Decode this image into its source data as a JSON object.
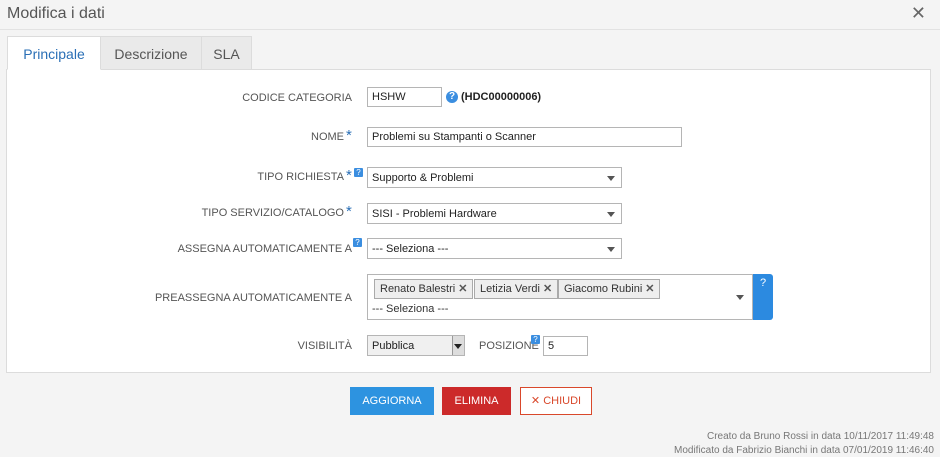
{
  "dialog": {
    "title": "Modifica i dati",
    "close_icon": "close-icon"
  },
  "tabs": [
    {
      "label": "Principale"
    },
    {
      "label": "Descrizione"
    },
    {
      "label": "SLA"
    }
  ],
  "form": {
    "codice_categoria": {
      "label": "CODICE CATEGORIA",
      "value": "HSHW",
      "code": "(HDC00000006)"
    },
    "nome": {
      "label": "NOME",
      "required_mark": "*",
      "value": "Problemi su  Stampanti o Scanner"
    },
    "tipo_richiesta": {
      "label": "TIPO RICHIESTA",
      "required_mark": "*",
      "help": "?",
      "value": "Supporto & Problemi"
    },
    "tipo_servizio": {
      "label": "TIPO SERVIZIO/CATALOGO",
      "required_mark": "*",
      "value": "SISI - Problemi Hardware"
    },
    "assegna": {
      "label": "ASSEGNA AUTOMATICAMENTE A",
      "help": "?",
      "value": "--- Seleziona ---"
    },
    "preassegna": {
      "label": "PREASSEGNA AUTOMATICAMENTE A",
      "tags": [
        {
          "label": "Renato Balestri"
        },
        {
          "label": "Letizia Verdi"
        },
        {
          "label": "Giacomo Rubini"
        }
      ],
      "remove_glyph": "✕",
      "placeholder": "--- Seleziona ---",
      "help": "?"
    },
    "visibilita": {
      "label": "VISIBILITÀ",
      "value": "Pubblica"
    },
    "posizione": {
      "label": "POSIZIONE",
      "help": "?",
      "value": "5"
    }
  },
  "buttons": {
    "update": "AGGIORNA",
    "delete": "ELIMINA",
    "close": "CHIUDI",
    "close_glyph": "✕"
  },
  "footer": {
    "created": "Creato da Bruno Rossi in data 10/11/2017 11:49:48",
    "modified": "Modificato da Fabrizio Bianchi in data 07/01/2019 11:46:40"
  },
  "colors": {
    "accent": "#2d93e0",
    "danger": "#cc2a2a",
    "tab_active_text": "#2a6fb6"
  }
}
